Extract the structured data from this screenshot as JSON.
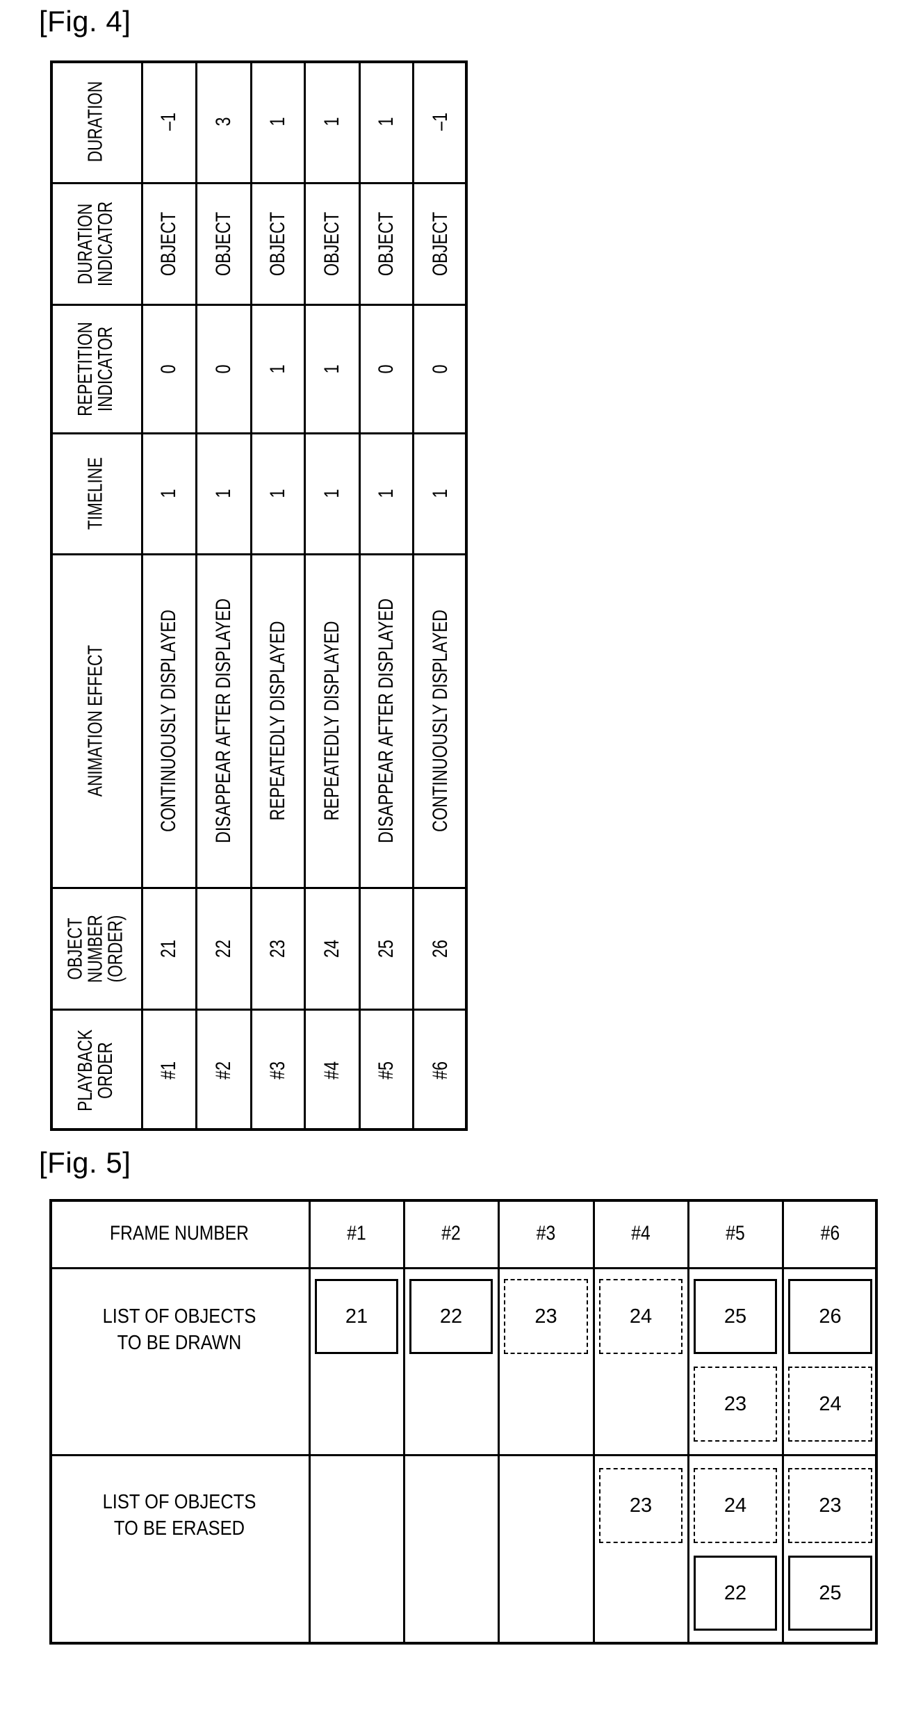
{
  "fig4": {
    "label": "[Fig. 4]",
    "row_headers": [
      "DURATION",
      "DURATION\nINDICATOR",
      "REPETITION\nINDICATOR",
      "TIMELINE",
      "ANIMATION EFFECT",
      "OBJECT\nNUMBER\n(ORDER)",
      "PLAYBACK\nORDER"
    ],
    "rows": [
      {
        "playback_order": "#1",
        "object_number": "21",
        "animation_effect": "CONTINUOUSLY DISPLAYED",
        "timeline": "1",
        "repetition_indicator": "0",
        "duration_indicator": "OBJECT",
        "duration": "–1"
      },
      {
        "playback_order": "#2",
        "object_number": "22",
        "animation_effect": "DISAPPEAR AFTER DISPLAYED",
        "timeline": "1",
        "repetition_indicator": "0",
        "duration_indicator": "OBJECT",
        "duration": "3"
      },
      {
        "playback_order": "#3",
        "object_number": "23",
        "animation_effect": "REPEATEDLY DISPLAYED",
        "timeline": "1",
        "repetition_indicator": "1",
        "duration_indicator": "OBJECT",
        "duration": "1"
      },
      {
        "playback_order": "#4",
        "object_number": "24",
        "animation_effect": "REPEATEDLY DISPLAYED",
        "timeline": "1",
        "repetition_indicator": "1",
        "duration_indicator": "OBJECT",
        "duration": "1"
      },
      {
        "playback_order": "#5",
        "object_number": "25",
        "animation_effect": "DISAPPEAR AFTER DISPLAYED",
        "timeline": "1",
        "repetition_indicator": "0",
        "duration_indicator": "OBJECT",
        "duration": "1"
      },
      {
        "playback_order": "#6",
        "object_number": "26",
        "animation_effect": "CONTINUOUSLY DISPLAYED",
        "timeline": "1",
        "repetition_indicator": "0",
        "duration_indicator": "OBJECT",
        "duration": "–1"
      }
    ]
  },
  "fig5": {
    "label": "[Fig. 5]",
    "header_label": "FRAME NUMBER",
    "drawn_label": "LIST OF OBJECTS\nTO BE DRAWN",
    "erased_label": "LIST OF OBJECTS\nTO BE ERASED",
    "frames": [
      {
        "number": "#1",
        "drawn": [
          {
            "id": "21",
            "style": "solid"
          }
        ],
        "erased": []
      },
      {
        "number": "#2",
        "drawn": [
          {
            "id": "22",
            "style": "solid"
          }
        ],
        "erased": []
      },
      {
        "number": "#3",
        "drawn": [
          {
            "id": "23",
            "style": "dashed"
          }
        ],
        "erased": []
      },
      {
        "number": "#4",
        "drawn": [
          {
            "id": "24",
            "style": "dashed"
          }
        ],
        "erased": [
          {
            "id": "23",
            "style": "dashed"
          }
        ]
      },
      {
        "number": "#5",
        "drawn": [
          {
            "id": "25",
            "style": "solid"
          },
          {
            "id": "23",
            "style": "dashed"
          }
        ],
        "erased": [
          {
            "id": "24",
            "style": "dashed"
          },
          {
            "id": "22",
            "style": "solid"
          }
        ]
      },
      {
        "number": "#6",
        "drawn": [
          {
            "id": "26",
            "style": "solid"
          },
          {
            "id": "24",
            "style": "dashed"
          }
        ],
        "erased": [
          {
            "id": "23",
            "style": "dashed"
          },
          {
            "id": "25",
            "style": "solid"
          }
        ]
      }
    ]
  }
}
